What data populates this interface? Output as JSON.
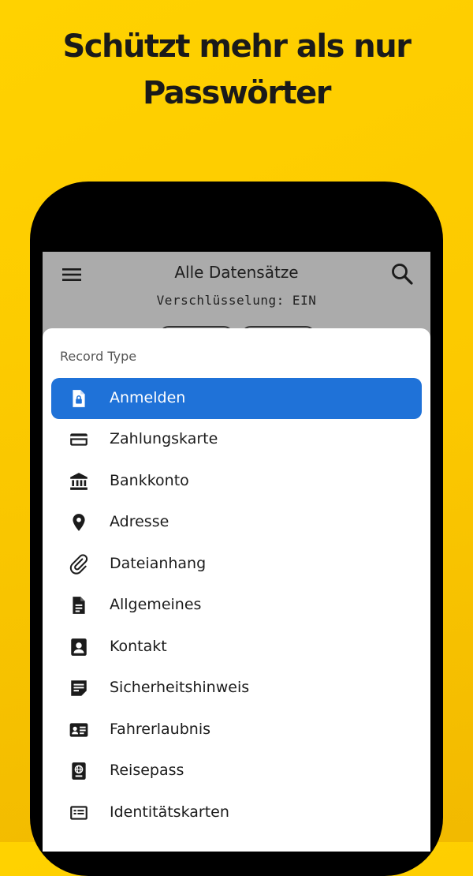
{
  "headline": {
    "line1": "Schützt mehr als nur",
    "line2": "Passwörter"
  },
  "appbar": {
    "title": "Alle Datensätze",
    "encryption_status": "Verschlüsselung: EIN",
    "menu_icon": "hamburger-menu-icon",
    "search_icon": "search-icon"
  },
  "sheet": {
    "title": "Record Type",
    "selected_index": 0,
    "items": [
      {
        "label": "Anmelden",
        "icon": "login-file-lock-icon"
      },
      {
        "label": "Zahlungskarte",
        "icon": "credit-card-icon"
      },
      {
        "label": "Bankkonto",
        "icon": "bank-icon"
      },
      {
        "label": "Adresse",
        "icon": "location-pin-icon"
      },
      {
        "label": "Dateianhang",
        "icon": "paperclip-icon"
      },
      {
        "label": "Allgemeines",
        "icon": "document-icon"
      },
      {
        "label": "Kontakt",
        "icon": "contact-card-icon"
      },
      {
        "label": "Sicherheitshinweis",
        "icon": "sticky-note-icon"
      },
      {
        "label": "Fahrerlaubnis",
        "icon": "drivers-license-icon"
      },
      {
        "label": "Reisepass",
        "icon": "passport-icon"
      },
      {
        "label": "Identitätskarten",
        "icon": "id-card-icon"
      }
    ]
  },
  "colors": {
    "background": "#fcc900",
    "selected": "#1f72d8",
    "scrim": "#ababab"
  }
}
